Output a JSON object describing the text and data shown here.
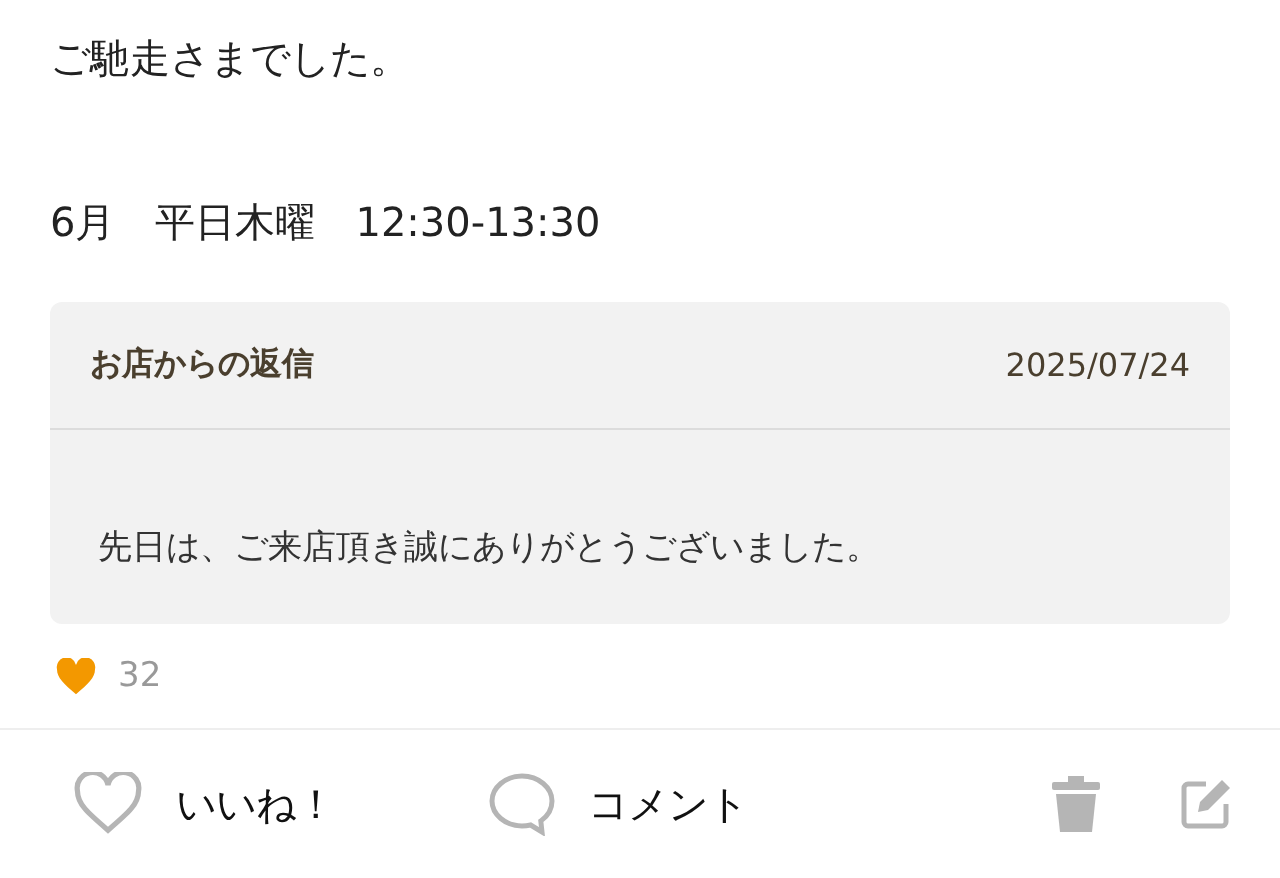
{
  "review": {
    "closing": "ご馳走さまでした。",
    "visit": "6月　平日木曜　12:30-13:30"
  },
  "reply": {
    "title": "お店からの返信",
    "date": "2025/07/24",
    "body": "先日は、ご来店頂き誠にありがとうございました。"
  },
  "likes": {
    "count": "32"
  },
  "actions": [
    {
      "kind": "like",
      "label": "いいね！",
      "selected": false
    },
    {
      "kind": "comment",
      "label": "コメント"
    },
    {
      "kind": "delete"
    },
    {
      "kind": "edit"
    }
  ]
}
